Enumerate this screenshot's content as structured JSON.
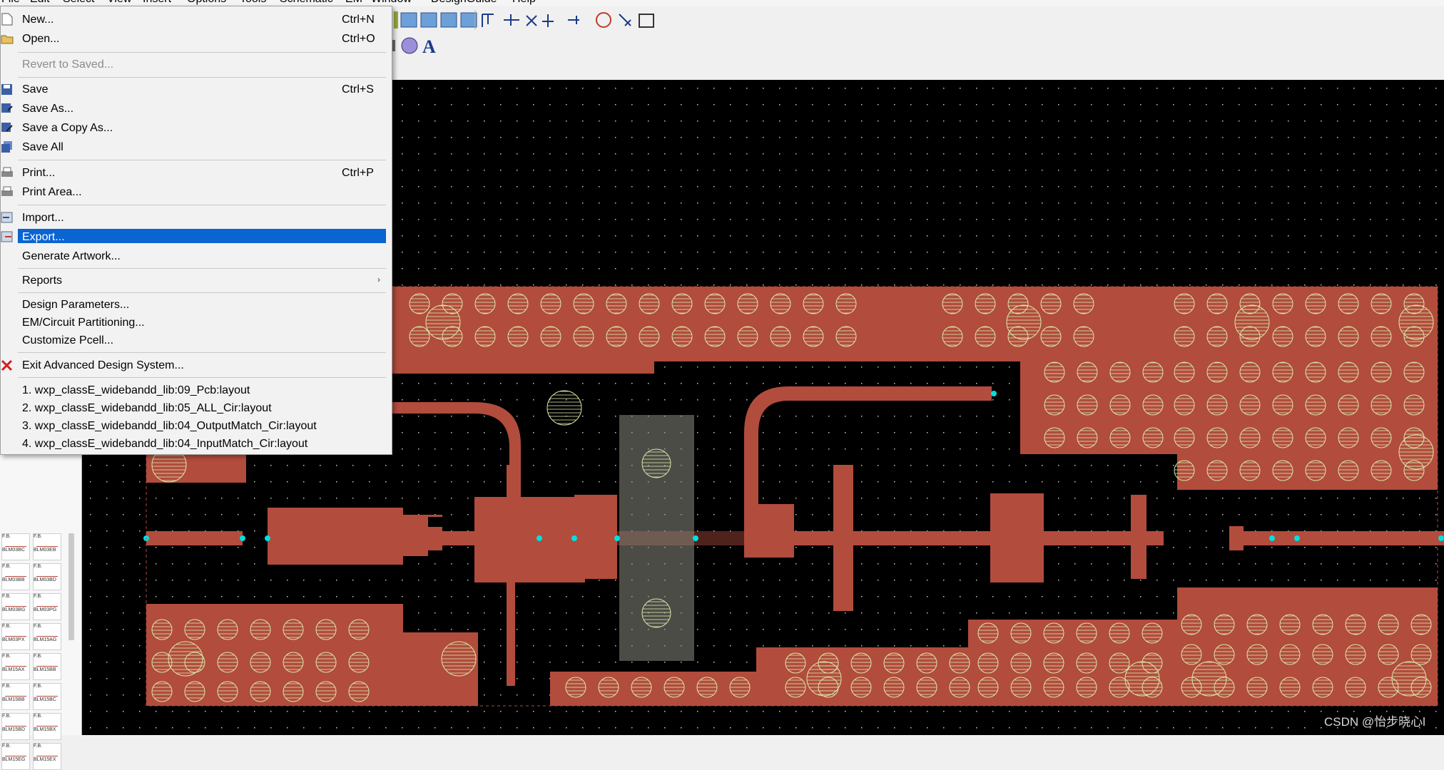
{
  "menubar": {
    "items": [
      "File",
      "Edit",
      "Select",
      "View",
      "Insert",
      "Options",
      "Tools",
      "Schematic",
      "EM",
      "Window",
      "DesignGuide",
      "Help"
    ]
  },
  "file_menu": {
    "items": [
      {
        "label": "New...",
        "shortcut": "Ctrl+N",
        "icon": "new-file-icon"
      },
      {
        "label": "Open...",
        "shortcut": "Ctrl+O",
        "icon": "open-folder-icon"
      },
      {
        "label": "Revert to Saved...",
        "disabled": true
      },
      {
        "label": "Save",
        "shortcut": "Ctrl+S",
        "icon": "save-icon"
      },
      {
        "label": "Save As...",
        "icon": "save-as-icon"
      },
      {
        "label": "Save a Copy As...",
        "icon": "save-copy-icon"
      },
      {
        "label": "Save All",
        "icon": "save-all-icon"
      },
      {
        "label": "Print...",
        "shortcut": "Ctrl+P",
        "icon": "print-icon"
      },
      {
        "label": "Print Area...",
        "icon": "print-area-icon"
      },
      {
        "label": "Import...",
        "icon": "import-icon"
      },
      {
        "label": "Export...",
        "icon": "export-icon",
        "highlighted": true
      },
      {
        "label": "Generate Artwork..."
      },
      {
        "label": "Reports",
        "submenu": true
      },
      {
        "label": "Design Parameters..."
      },
      {
        "label": "EM/Circuit Partitioning..."
      },
      {
        "label": "Customize Pcell..."
      },
      {
        "label": "Exit Advanced Design System...",
        "icon": "exit-icon"
      },
      {
        "label": "1. wxp_classE_widebandd_lib:09_Pcb:layout"
      },
      {
        "label": "2. wxp_classE_widebandd_lib:05_ALL_Cir:layout"
      },
      {
        "label": "3. wxp_classE_widebandd_lib:04_OutputMatch_Cir:layout"
      },
      {
        "label": "4. wxp_classE_widebandd_lib:04_InputMatch_Cir:layout"
      }
    ]
  },
  "library_items": [
    "BLM03BC",
    "BLM03EB",
    "BLM03BB",
    "BLM03BD",
    "BLM03BG",
    "BLM03PG",
    "BLM03PX",
    "BLM15AG",
    "BLM15AX",
    "BLM15BB",
    "BLM15BB",
    "BLM15BC",
    "BLM15BD",
    "BLM15BX",
    "BLM15EG",
    "BLM15EX"
  ],
  "library_prefix": "F.B.",
  "colors": {
    "canvas": "#000000",
    "metal": "#b24c3d",
    "via_outline": "#d9e8a8",
    "menu_highlight": "#0a64d2",
    "grid_dot": "#c8c8c8"
  },
  "watermark": "CSDN @怡步晓心l"
}
